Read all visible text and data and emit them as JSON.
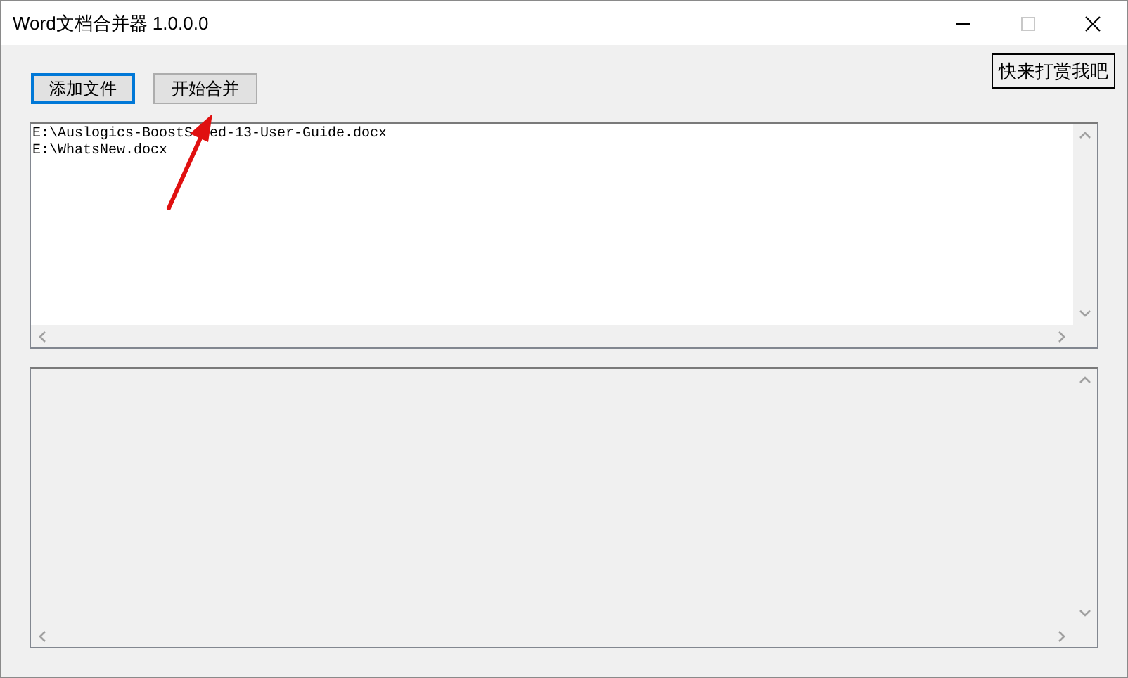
{
  "window": {
    "title": "Word文档合并器 1.0.0.0"
  },
  "toolbar": {
    "buttons": [
      {
        "label": "添加文件",
        "focused": true
      },
      {
        "label": "开始合并",
        "focused": false
      }
    ],
    "reward_button": "快来打赏我吧"
  },
  "file_list": {
    "items": [
      "E:\\Auslogics-BoostS  ed-13-User-Guide.docx",
      "E:\\WhatsNew.docx"
    ]
  }
}
